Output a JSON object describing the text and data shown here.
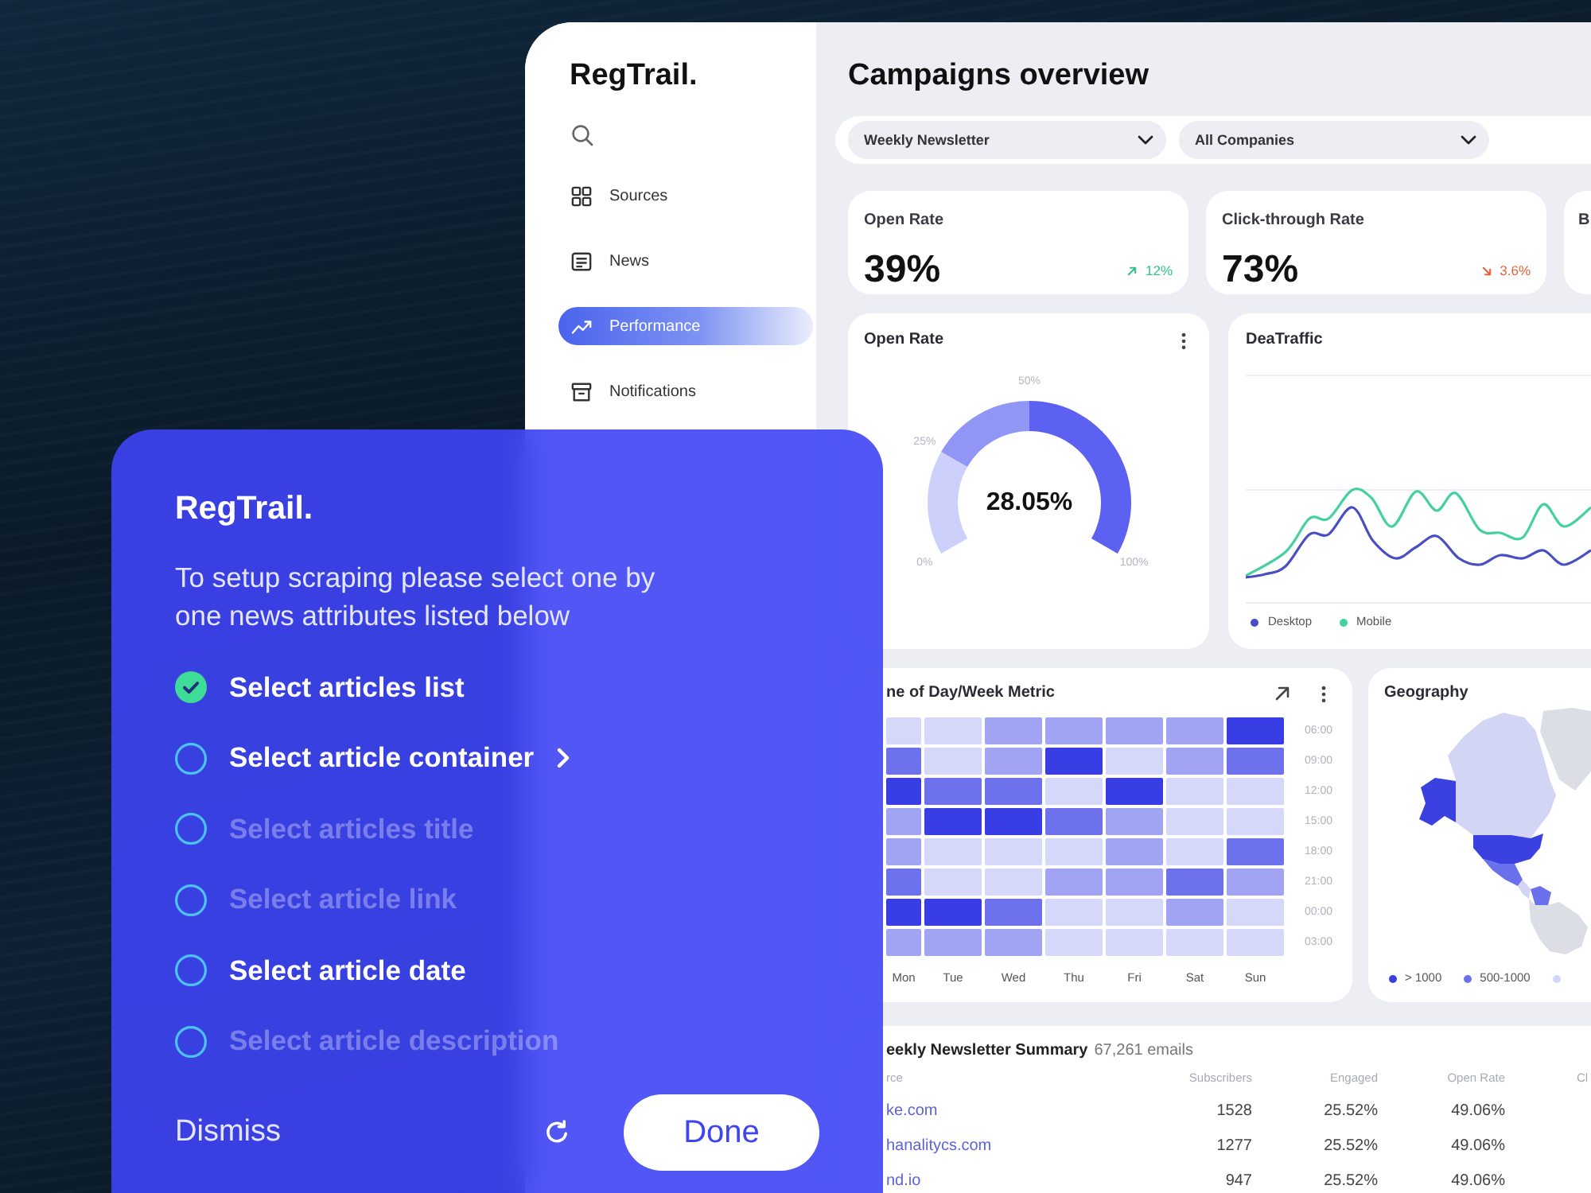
{
  "dashboard": {
    "logo": "RegTrail.",
    "nav": [
      {
        "label": "Sources",
        "kind": "grid",
        "selected": false
      },
      {
        "label": "News",
        "kind": "document",
        "selected": false
      },
      {
        "label": "Performance",
        "kind": "trend",
        "selected": true
      },
      {
        "label": "Notifications",
        "kind": "box",
        "selected": false
      }
    ],
    "title": "Campaigns overview",
    "filters": [
      {
        "value": "Weekly Newsletter"
      },
      {
        "value": "All Companies"
      }
    ],
    "kpis": [
      {
        "label": "Open Rate",
        "value": "39%",
        "change": "12%",
        "kind": "up"
      },
      {
        "label": "Click-through Rate",
        "value": "73%",
        "change": "3.6%",
        "kind": "down"
      },
      {
        "label": "B"
      }
    ],
    "gauge": {
      "title": "Open Rate",
      "value": "28.05%",
      "ticks": [
        "0%",
        "25%",
        "50%",
        "100%"
      ],
      "segments": [
        {
          "color": "#cdd0fa"
        },
        {
          "color": "#9196f6"
        },
        {
          "color": "#5c61f1"
        }
      ]
    },
    "traffic": {
      "title": "DeaTraffic",
      "legend": [
        {
          "label": "Desktop",
          "color": "#4a4ec4"
        },
        {
          "label": "Mobile",
          "color": "#45d0a2"
        }
      ]
    },
    "heatmap": {
      "title": "ne of Day/Week Metric",
      "columns": [
        "Mon",
        "Tue",
        "Wed",
        "Thu",
        "Fri",
        "Sat",
        "Sun"
      ],
      "rows": [
        {
          "label": "06:00",
          "cells": [
            {
              "color": "#d6d8fa"
            },
            {
              "color": "#d6d8fa"
            },
            {
              "color": "#a1a4f3"
            },
            {
              "color": "#a1a4f3"
            },
            {
              "color": "#a1a4f3"
            },
            {
              "color": "#a1a4f3"
            },
            {
              "color": "#383de4"
            }
          ]
        },
        {
          "label": "09:00",
          "cells": [
            {
              "color": "#6d71eb"
            },
            {
              "color": "#d6d8fa"
            },
            {
              "color": "#a1a4f3"
            },
            {
              "color": "#383de4"
            },
            {
              "color": "#d6d8fa"
            },
            {
              "color": "#a1a4f3"
            },
            {
              "color": "#6d71eb"
            }
          ]
        },
        {
          "label": "12:00",
          "cells": [
            {
              "color": "#383de4"
            },
            {
              "color": "#6d71eb"
            },
            {
              "color": "#6d71eb"
            },
            {
              "color": "#d6d8fa"
            },
            {
              "color": "#383de4"
            },
            {
              "color": "#d6d8fa"
            },
            {
              "color": "#d6d8fa"
            }
          ]
        },
        {
          "label": "15:00",
          "cells": [
            {
              "color": "#a1a4f3"
            },
            {
              "color": "#383de4"
            },
            {
              "color": "#383de4"
            },
            {
              "color": "#6d71eb"
            },
            {
              "color": "#a1a4f3"
            },
            {
              "color": "#d6d8fa"
            },
            {
              "color": "#d6d8fa"
            }
          ]
        },
        {
          "label": "18:00",
          "cells": [
            {
              "color": "#a1a4f3"
            },
            {
              "color": "#d6d8fa"
            },
            {
              "color": "#d6d8fa"
            },
            {
              "color": "#d6d8fa"
            },
            {
              "color": "#a1a4f3"
            },
            {
              "color": "#d6d8fa"
            },
            {
              "color": "#6d71eb"
            }
          ]
        },
        {
          "label": "21:00",
          "cells": [
            {
              "color": "#6d71eb"
            },
            {
              "color": "#d6d8fa"
            },
            {
              "color": "#d6d8fa"
            },
            {
              "color": "#a1a4f3"
            },
            {
              "color": "#a1a4f3"
            },
            {
              "color": "#6d71eb"
            },
            {
              "color": "#a1a4f3"
            }
          ]
        },
        {
          "label": "00:00",
          "cells": [
            {
              "color": "#383de4"
            },
            {
              "color": "#383de4"
            },
            {
              "color": "#6d71eb"
            },
            {
              "color": "#d6d8fa"
            },
            {
              "color": "#d6d8fa"
            },
            {
              "color": "#a1a4f3"
            },
            {
              "color": "#d6d8fa"
            }
          ]
        },
        {
          "label": "03:00",
          "cells": [
            {
              "color": "#a1a4f3"
            },
            {
              "color": "#a1a4f3"
            },
            {
              "color": "#a1a4f3"
            },
            {
              "color": "#d6d8fa"
            },
            {
              "color": "#d6d8fa"
            },
            {
              "color": "#d6d8fa"
            },
            {
              "color": "#d6d8fa"
            }
          ]
        }
      ]
    },
    "geography": {
      "title": "Geography",
      "legend": [
        {
          "label": "> 1000",
          "color": "#3b40e0"
        },
        {
          "label": "500-1000",
          "color": "#6b70ec"
        },
        {
          "color": "#d3d5f5"
        }
      ]
    },
    "summary": {
      "title": "eekly Newsletter Summary",
      "count": "67,261 emails",
      "columns": [
        "rce",
        "Subscribers",
        "Engaged",
        "Open Rate",
        "Cl"
      ],
      "rows": [
        [
          "ke.com",
          "1528",
          "25.52%",
          "49.06%"
        ],
        [
          "hanalitycs.com",
          "1277",
          "25.52%",
          "49.06%"
        ],
        [
          "nd.io",
          "947",
          "25.52%",
          "49.06%"
        ]
      ]
    }
  },
  "modal": {
    "logo": "RegTrail.",
    "intro": "To setup scraping please select one by one news attributes listed below",
    "steps": [
      {
        "label": "Select articles list",
        "checked": true,
        "disabled": false,
        "selected": false
      },
      {
        "label": "Select article container",
        "checked": false,
        "disabled": false,
        "selected": true
      },
      {
        "label": "Select articles title",
        "checked": false,
        "disabled": true,
        "selected": false
      },
      {
        "label": "Select article link",
        "checked": false,
        "disabled": true,
        "selected": false
      },
      {
        "label": "Select article date",
        "checked": false,
        "disabled": false,
        "selected": false
      },
      {
        "label": "Select article description",
        "checked": false,
        "disabled": true,
        "selected": false
      }
    ],
    "dismiss": "Dismiss",
    "done": "Done"
  }
}
